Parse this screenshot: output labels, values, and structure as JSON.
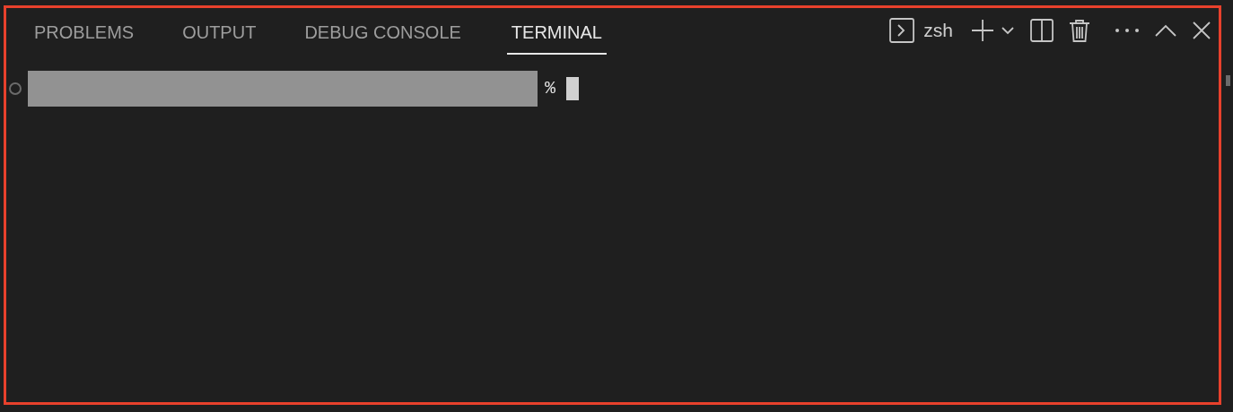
{
  "tabs": [
    {
      "label": "PROBLEMS",
      "selected": false
    },
    {
      "label": "OUTPUT",
      "selected": false
    },
    {
      "label": "DEBUG CONSOLE",
      "selected": false
    },
    {
      "label": "TERMINAL",
      "selected": true
    }
  ],
  "terminal": {
    "profile": "zsh",
    "prompt": "%"
  }
}
